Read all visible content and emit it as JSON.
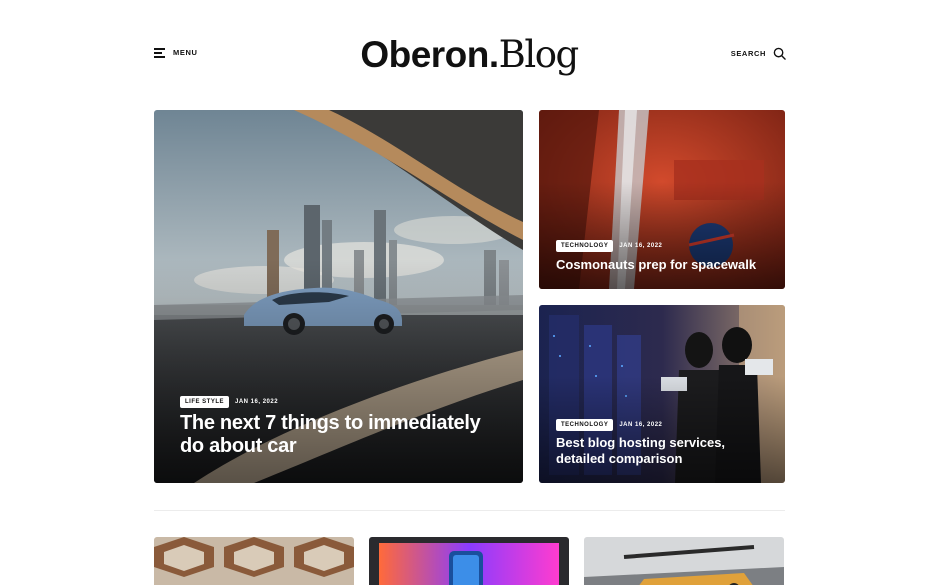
{
  "header": {
    "menu_label": "MENU",
    "logo_bold": "Oberon.",
    "logo_serif": "Blog",
    "search_label": "SEARCH"
  },
  "featured": {
    "category": "LIFE STYLE",
    "date": "JAN 16, 2022",
    "title": "The next 7 things to immediately do about car"
  },
  "side_posts": [
    {
      "category": "TECHNOLOGY",
      "date": "JAN 16, 2022",
      "title": "Cosmonauts prep for spacewalk"
    },
    {
      "category": "TECHNOLOGY",
      "date": "JAN 16, 2022",
      "title": "Best blog hosting services, detailed comparison"
    }
  ]
}
